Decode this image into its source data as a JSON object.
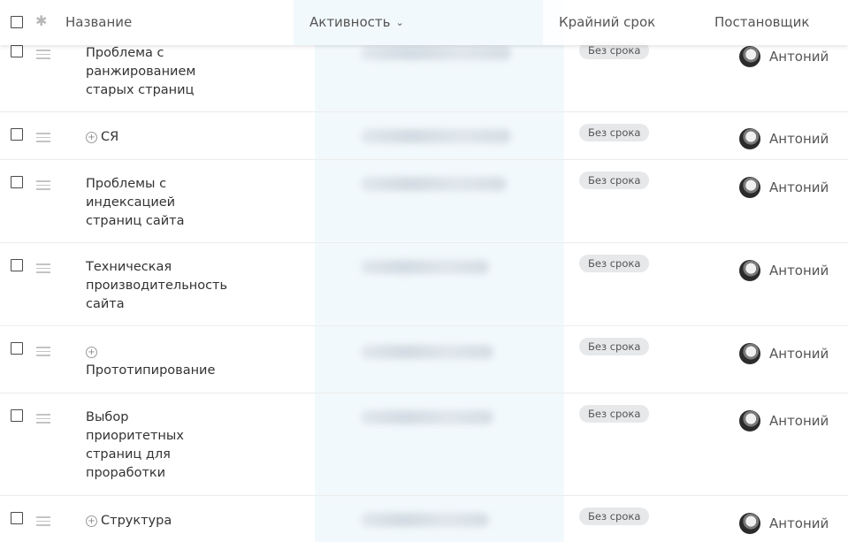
{
  "header": {
    "name_label": "Название",
    "activity_label": "Активность",
    "deadline_label": "Крайний срок",
    "creator_label": "Постановщик"
  },
  "rows": [
    {
      "title": "Проблема с\nранжированием\nстарых страниц",
      "deadline": "Без срока",
      "assignee": "Антоний"
    },
    {
      "title": "СЯ",
      "deadline": "Без срока",
      "assignee": "Антоний"
    },
    {
      "title": "Проблемы с\nиндексацией\nстраниц сайта",
      "deadline": "Без срока",
      "assignee": "Антоний"
    },
    {
      "title": "Техническая\nпроизводительность\nсайта",
      "deadline": "Без срока",
      "assignee": "Антоний"
    },
    {
      "title": "Прототипирование",
      "deadline": "Без срока",
      "assignee": "Антоний"
    },
    {
      "title": "Выбор\nприоритетных\nстраниц для\nпроработки",
      "deadline": "Без срока",
      "assignee": "Антоний"
    },
    {
      "title": "Структура",
      "deadline": "Без срока",
      "assignee": "Антоний"
    }
  ],
  "icons": {
    "gear": "gear-icon",
    "drag": "drag-handle-icon",
    "expand": "plus-circle-icon",
    "sort": "chevron-down-icon"
  }
}
